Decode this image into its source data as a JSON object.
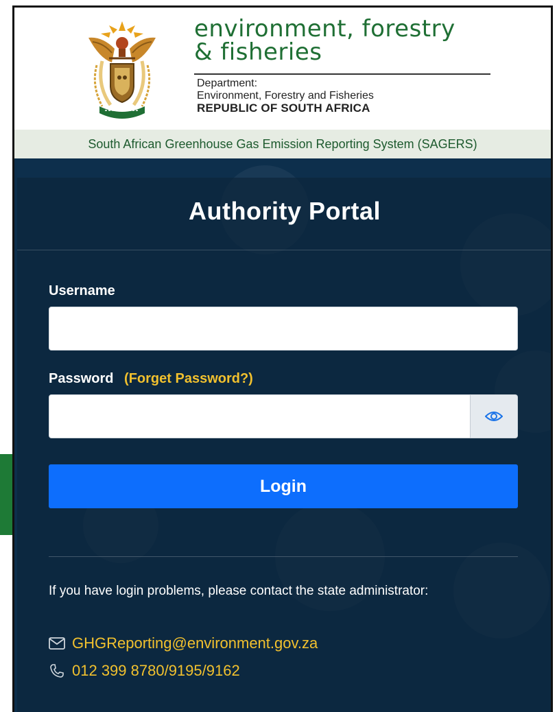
{
  "header": {
    "dept_line1": "environment, forestry",
    "dept_line2": "& fisheries",
    "dept_label": "Department:",
    "dept_full": "Environment, Forestry and Fisheries",
    "country": "REPUBLIC OF SOUTH AFRICA",
    "system_banner": "South African Greenhouse Gas Emission Reporting System (SAGERS)"
  },
  "login": {
    "title": "Authority Portal",
    "username_label": "Username",
    "username_value": "",
    "password_label": "Password",
    "forgot_link": "(Forget Password?)",
    "password_value": "",
    "login_button": "Login"
  },
  "help": {
    "message": "If you have login problems, please contact the state administrator:",
    "email": "GHGReporting@environment.gov.za",
    "phone": "012 399 8780/9195/9162"
  },
  "icons": {
    "coat_of_arms": "coat-of-arms",
    "toggle_password": "eye-icon",
    "email": "envelope-icon",
    "phone": "phone-icon"
  },
  "colors": {
    "brand_green": "#1f6f34",
    "card_background": "#0d2f4c",
    "primary_button": "#0d6efd",
    "link_accent": "#f2c12e"
  }
}
